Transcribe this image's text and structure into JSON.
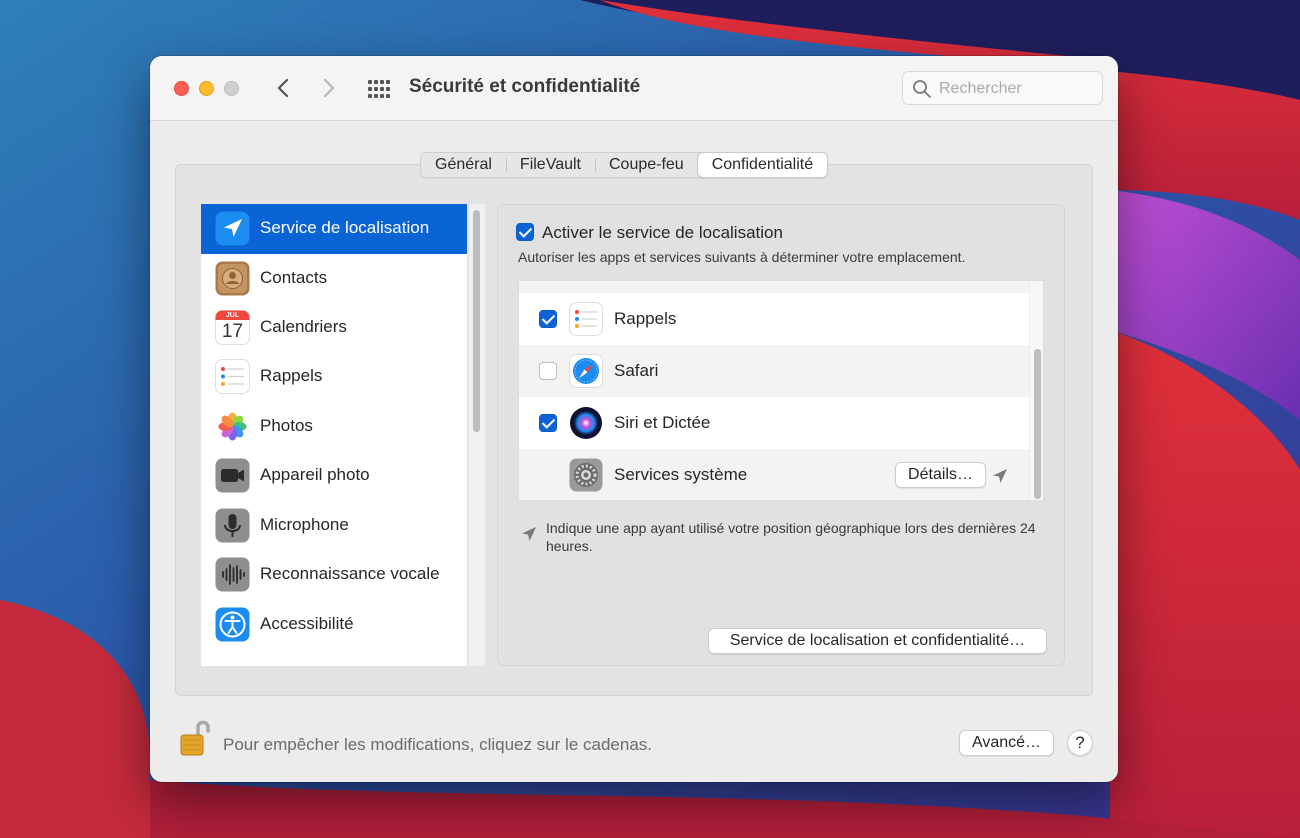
{
  "window": {
    "title": "Sécurité et confidentialité",
    "search_placeholder": "Rechercher"
  },
  "tabs": [
    {
      "label": "Général"
    },
    {
      "label": "FileVault"
    },
    {
      "label": "Coupe-feu"
    },
    {
      "label": "Confidentialité",
      "active": true
    }
  ],
  "sidebar": {
    "items": [
      {
        "label": "Service de localisation",
        "icon": "location-arrow-icon",
        "selected": true
      },
      {
        "label": "Contacts",
        "icon": "contacts-icon"
      },
      {
        "label": "Calendriers",
        "icon": "calendar-icon",
        "month": "JUL",
        "day": "17"
      },
      {
        "label": "Rappels",
        "icon": "reminders-icon"
      },
      {
        "label": "Photos",
        "icon": "photos-icon"
      },
      {
        "label": "Appareil photo",
        "icon": "camera-icon"
      },
      {
        "label": "Microphone",
        "icon": "microphone-icon"
      },
      {
        "label": "Reconnaissance vocale",
        "icon": "speech-recognition-icon"
      },
      {
        "label": "Accessibilité",
        "icon": "accessibility-icon"
      }
    ]
  },
  "location": {
    "enable_label": "Activer le service de localisation",
    "enabled": true,
    "description": "Autoriser les apps et services suivants à déterminer votre emplacement.",
    "apps": [
      {
        "label": "Rappels",
        "checked": true,
        "icon": "reminders-icon"
      },
      {
        "label": "Safari",
        "checked": false,
        "icon": "safari-icon"
      },
      {
        "label": "Siri et Dictée",
        "checked": true,
        "icon": "siri-icon"
      },
      {
        "label": "Services système",
        "icon": "system-preferences-icon",
        "details_label": "Détails…"
      }
    ],
    "note": "Indique une app ayant utilisé votre position géographique lors des dernières 24 heures.",
    "privacy_button": "Service de localisation et confidentialité…"
  },
  "footer": {
    "lock_text": "Pour empêcher les modifications, cliquez sur le cadenas.",
    "advanced_label": "Avancé…",
    "help_label": "?"
  },
  "colors": {
    "accent": "#0a64d6",
    "close": "#ff5f57",
    "minimize": "#febc2e"
  }
}
